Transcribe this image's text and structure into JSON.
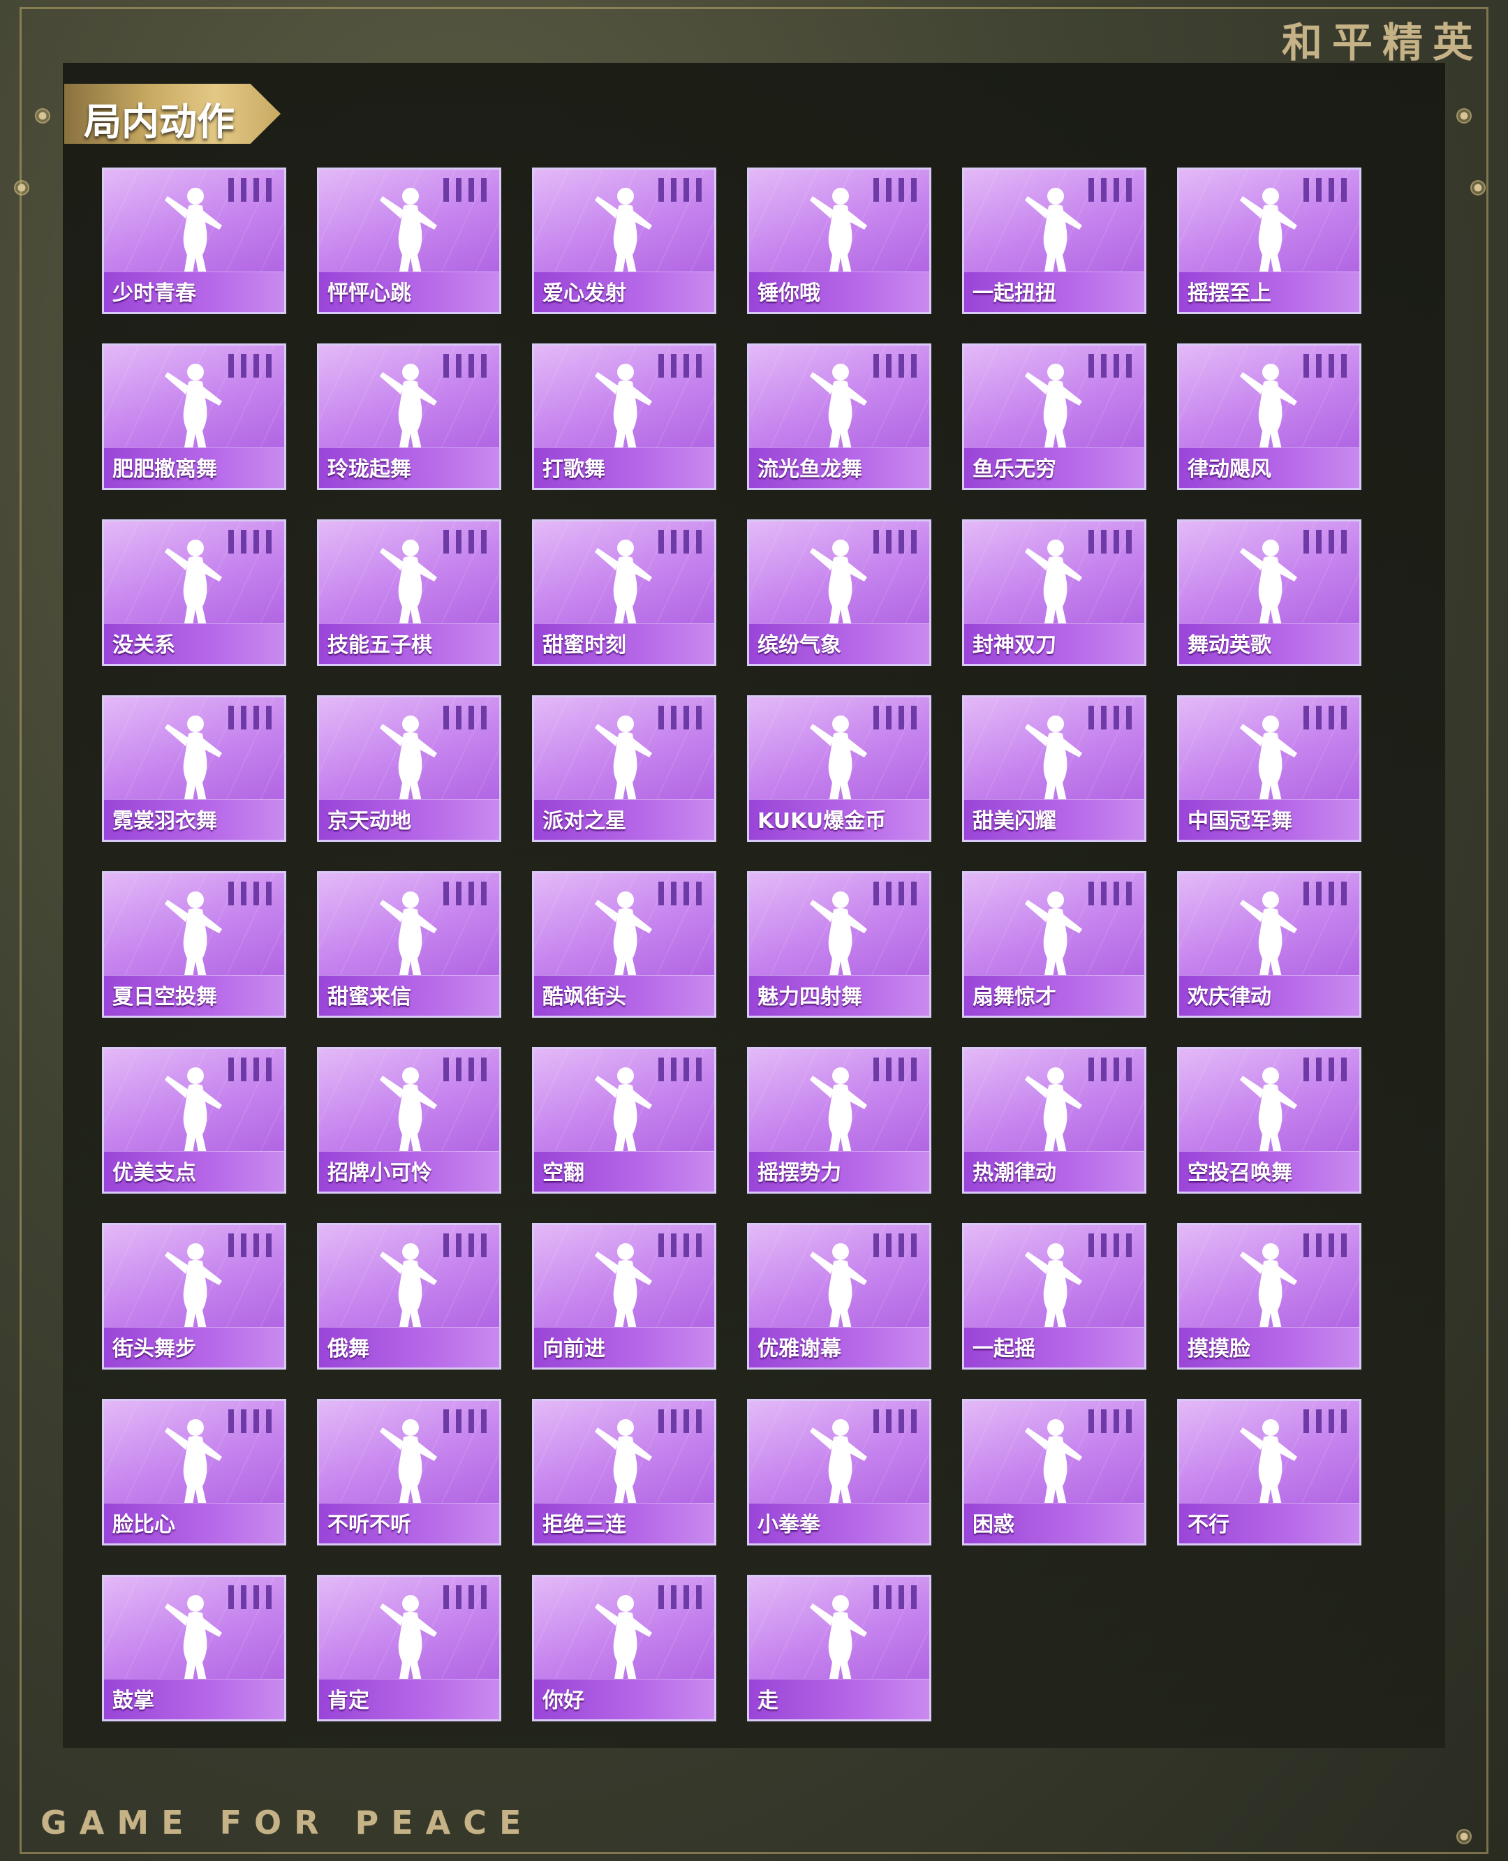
{
  "brand": "和平精英",
  "tagline": "GAME FOR PEACE",
  "section": {
    "title": "局内动作"
  },
  "accent_colors": {
    "card": "#c684ee",
    "label_bar": "#9a45d8",
    "gold": "#c5b287"
  },
  "emotes": [
    "少时青春",
    "怦怦心跳",
    "爱心发射",
    "锤你哦",
    "一起扭扭",
    "摇摆至上",
    "肥肥撤离舞",
    "玲珑起舞",
    "打歌舞",
    "流光鱼龙舞",
    "鱼乐无穷",
    "律动飓风",
    "没关系",
    "技能五子棋",
    "甜蜜时刻",
    "缤纷气象",
    "封神双刀",
    "舞动英歌",
    "霓裳羽衣舞",
    "京天动地",
    "派对之星",
    "KUKU爆金币",
    "甜美闪耀",
    "中国冠军舞",
    "夏日空投舞",
    "甜蜜来信",
    "酷飒街头",
    "魅力四射舞",
    "扇舞惊才",
    "欢庆律动",
    "优美支点",
    "招牌小可怜",
    "空翻",
    "摇摆势力",
    "热潮律动",
    "空投召唤舞",
    "街头舞步",
    "俄舞",
    "向前进",
    "优雅谢幕",
    "一起摇",
    "摸摸脸",
    "脸比心",
    "不听不听",
    "拒绝三连",
    "小拳拳",
    "困惑",
    "不行",
    "鼓掌",
    "肯定",
    "你好",
    "走"
  ]
}
